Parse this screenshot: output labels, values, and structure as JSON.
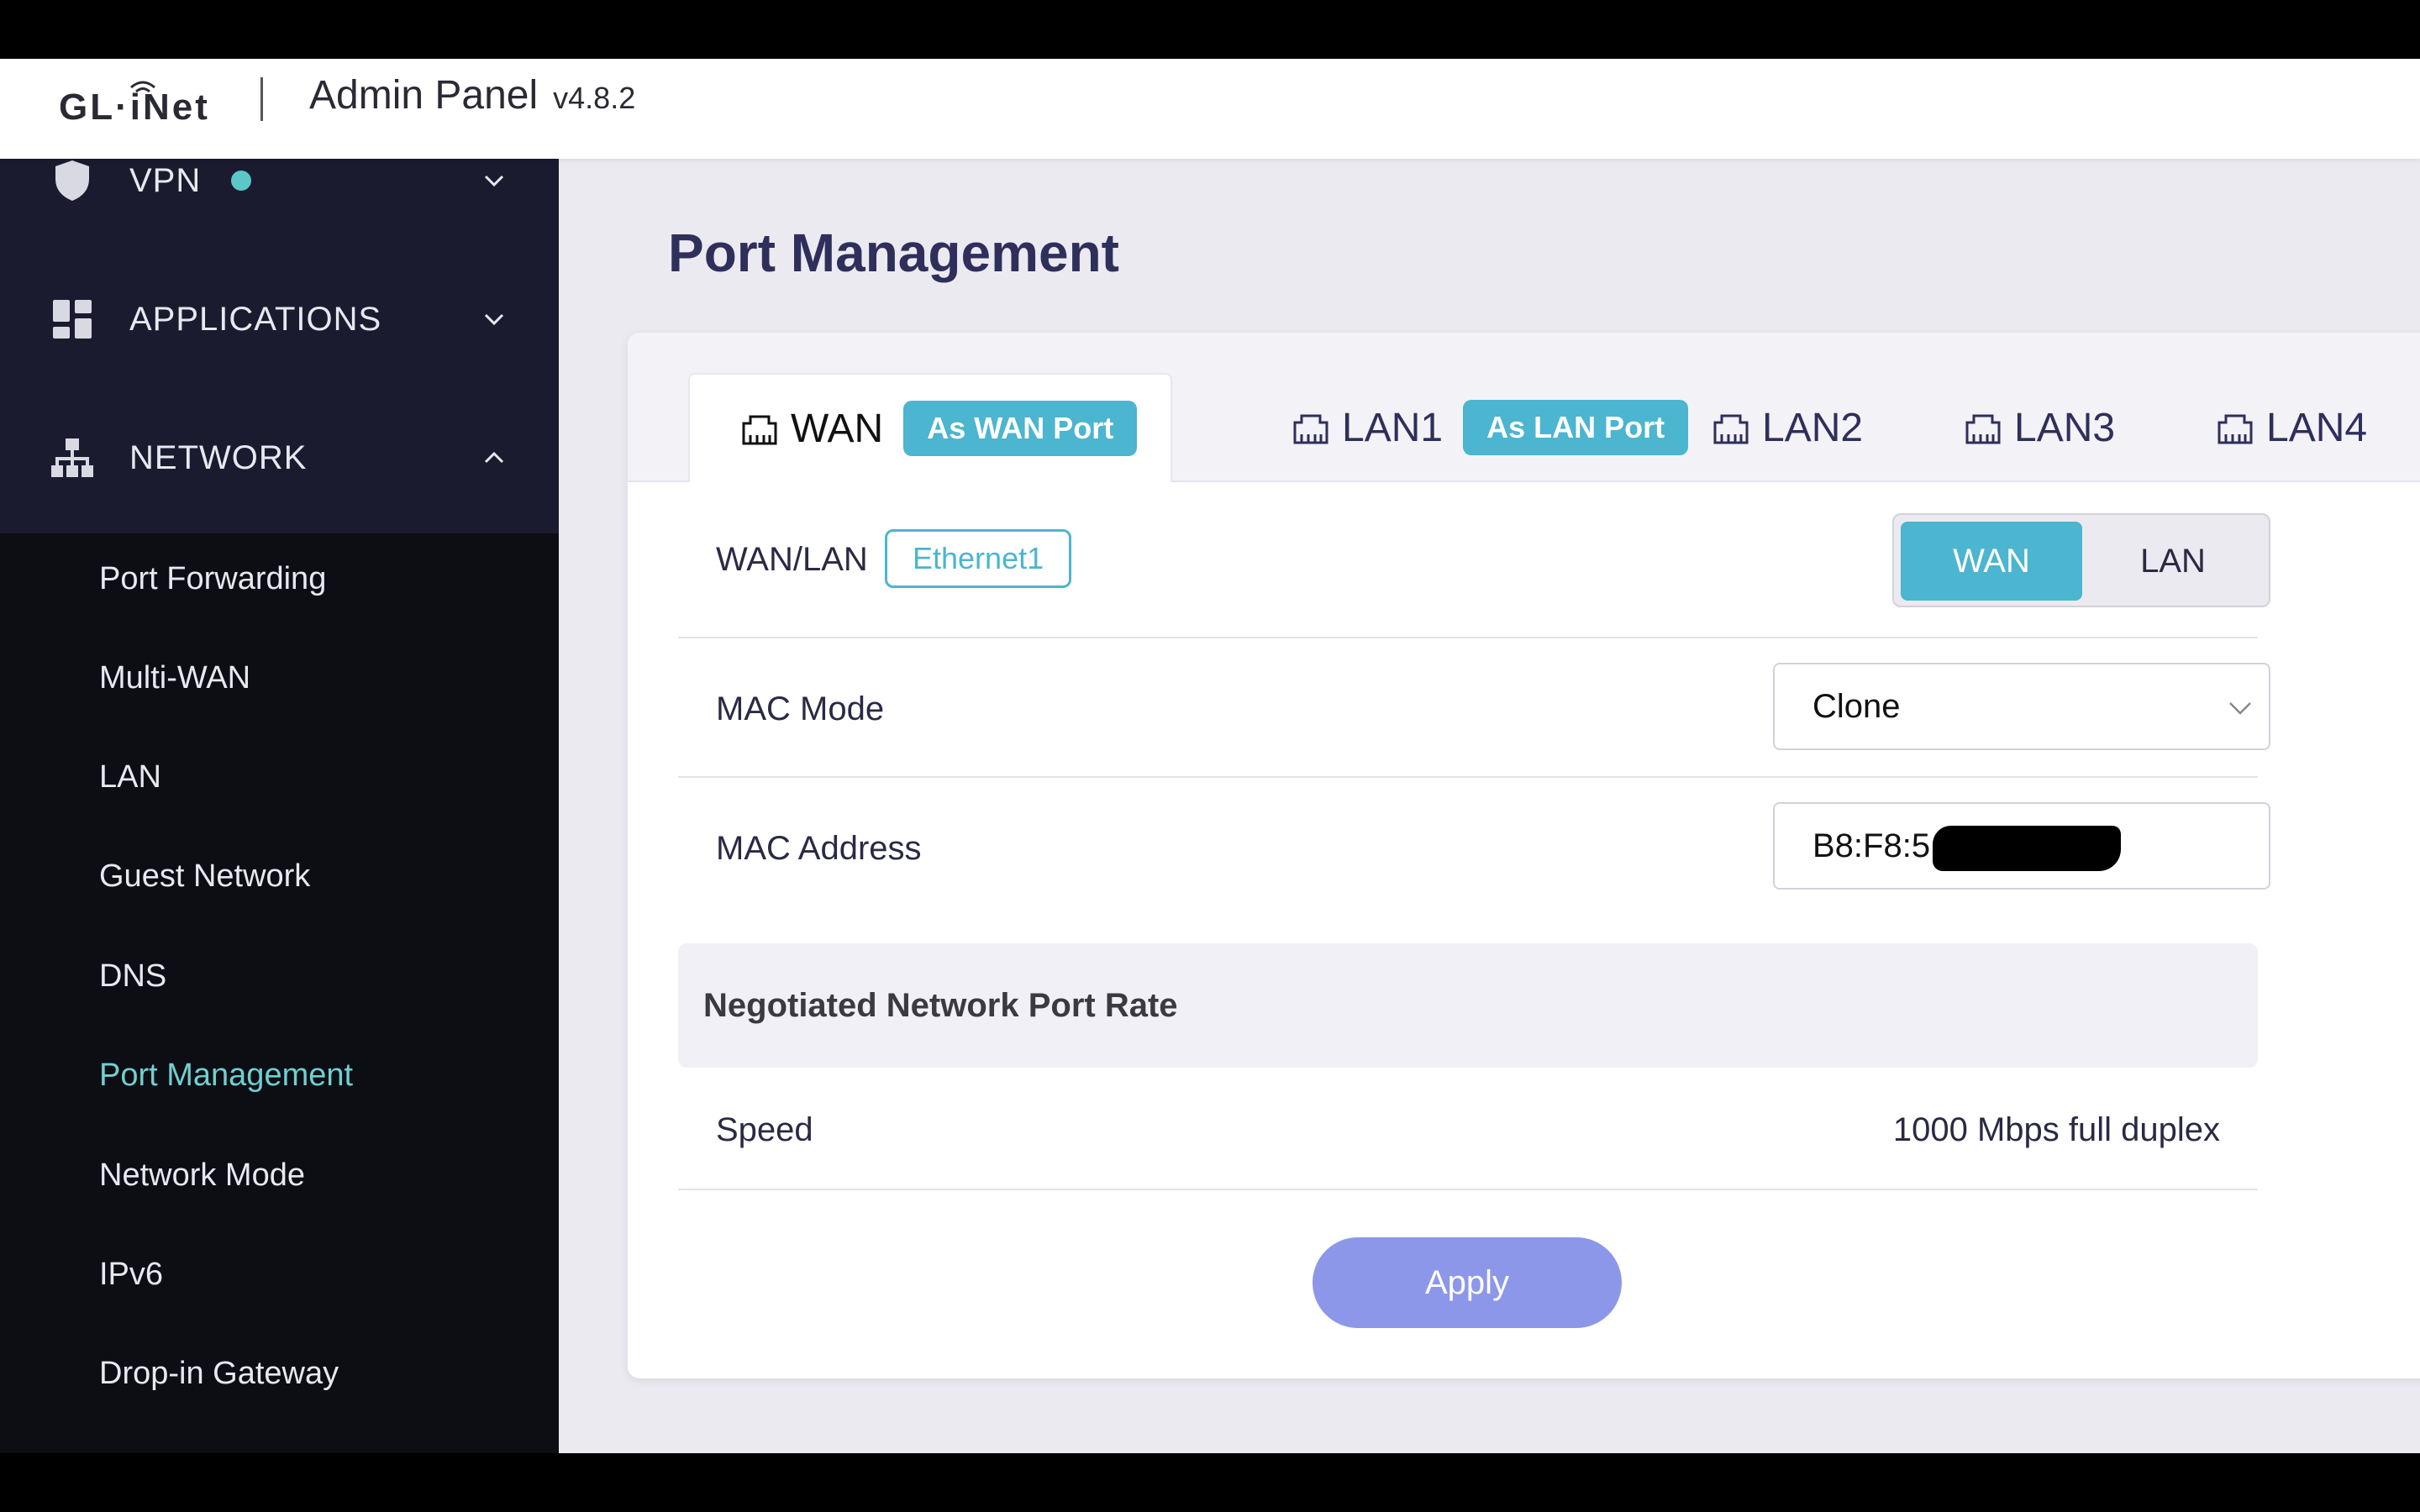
{
  "header": {
    "logo_text": "GL·iNet",
    "title": "Admin Panel",
    "version": "v4.8.2"
  },
  "sidebar": {
    "nav": [
      {
        "label": "VPN",
        "icon": "shield-icon",
        "status_dot": true
      },
      {
        "label": "APPLICATIONS",
        "icon": "grid-icon"
      },
      {
        "label": "NETWORK",
        "icon": "network-icon",
        "expanded": true
      }
    ],
    "submenu": [
      {
        "label": "Port Forwarding"
      },
      {
        "label": "Multi-WAN"
      },
      {
        "label": "LAN"
      },
      {
        "label": "Guest Network"
      },
      {
        "label": "DNS"
      },
      {
        "label": "Port Management",
        "active": true
      },
      {
        "label": "Network Mode"
      },
      {
        "label": "IPv6"
      },
      {
        "label": "Drop-in Gateway"
      }
    ]
  },
  "main": {
    "page_title": "Port Management",
    "tabs": [
      {
        "label": "WAN",
        "badge": "As WAN Port",
        "active": true
      },
      {
        "label": "LAN1",
        "badge": "As LAN Port"
      },
      {
        "label": "LAN2"
      },
      {
        "label": "LAN3"
      },
      {
        "label": "LAN4"
      }
    ],
    "wan_lan": {
      "label": "WAN/LAN",
      "tag": "Ethernet1",
      "options": [
        "WAN",
        "LAN"
      ],
      "selected": "WAN"
    },
    "mac_mode": {
      "label": "MAC Mode",
      "value": "Clone"
    },
    "mac_address": {
      "label": "MAC Address",
      "value": "B8:F8:5"
    },
    "section_title": "Negotiated Network Port Rate",
    "speed": {
      "label": "Speed",
      "value": "1000 Mbps full duplex"
    },
    "apply_label": "Apply"
  },
  "colors": {
    "accent": "#4cb5cf",
    "active_menu": "#6fd0cf",
    "sidebar_bg": "#1b1b30",
    "submenu_bg": "#0d0d14",
    "apply_btn": "#8d97ea",
    "title": "#2f2f5c"
  }
}
